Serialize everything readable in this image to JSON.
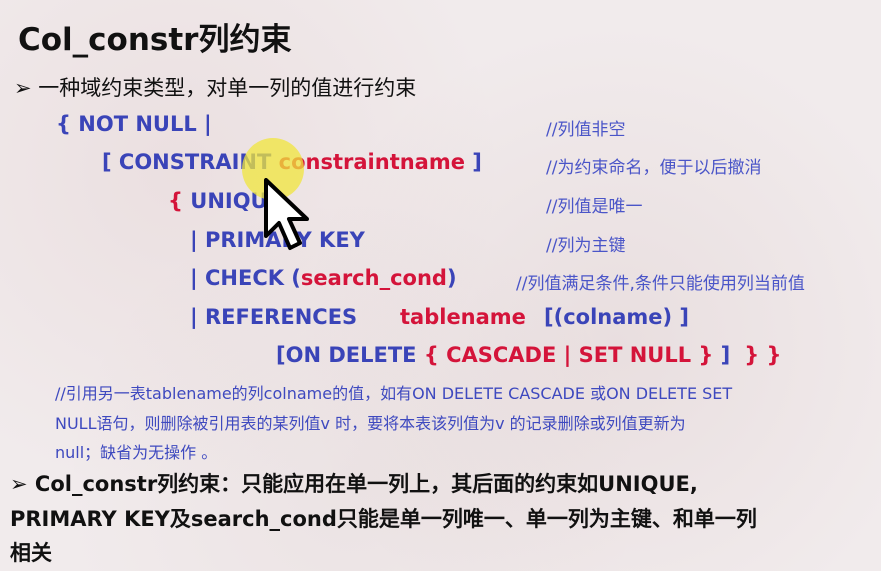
{
  "title": "Col_constr列约束",
  "bullet1": "一种域约束类型，对单一列的值进行约束",
  "syntax": {
    "l1": "{ NOT NULL |",
    "l2a": "[ CONSTRAINT ",
    "l2b": "constraintname",
    "l2c": " ]",
    "l3a": "{ ",
    "l3b": "UNIQUE",
    "l4": "| PRIMARY KEY",
    "l5a": "| CHECK  (",
    "l5b": "search_cond",
    "l5c": ")",
    "l6a": "| REFERENCES",
    "l6b": "tablename",
    "l6c": "[(colname) ]",
    "l7a": "[ON DELETE ",
    "l7b": "{ CASCADE | SET NULL }",
    "l7c": " ]",
    "l7d": "} }"
  },
  "comments": {
    "c1": "//列值非空",
    "c2": "//为约束命名，便于以后撤消",
    "c3": "//列值是唯一",
    "c4": "//列为主键",
    "c5": "//列值满足条件,条件只能使用列当前值"
  },
  "note": {
    "line1": "//引用另一表tablename的列colname的值，如有ON DELETE CASCADE 或ON DELETE SET",
    "line2": "NULL语句，则删除被引用表的某列值v 时，要将本表该列值为v  的记录删除或列值更新为",
    "line3": "null；缺省为无操作  。"
  },
  "bottom": {
    "line1": "Col_constr列约束：只能应用在单一列上，其后面的约束如UNIQUE,",
    "line2": "PRIMARY KEY及search_cond只能是单一列唯一、单一列为主键、和单一列",
    "line3": "相关"
  },
  "bullet_glyph": "➢",
  "colors": {
    "keyword": "#3a44b8",
    "accent": "#d4143a",
    "comment": "#4a55c8"
  }
}
